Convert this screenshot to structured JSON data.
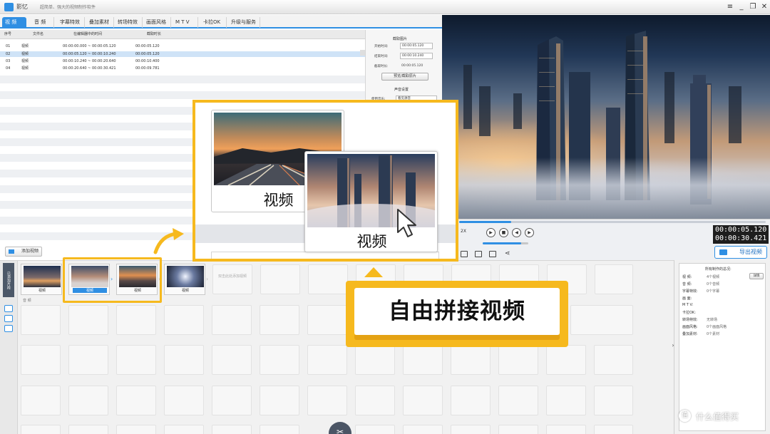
{
  "app": {
    "name": "影忆",
    "slogan": "超简单、强大的视频制作软件",
    "window_buttons": [
      "≡",
      "_",
      "❐",
      "✕"
    ]
  },
  "tabs": [
    {
      "label": "视 频",
      "active": true
    },
    {
      "label": "音 频",
      "active": false
    },
    {
      "label": "字幕特效",
      "active": false
    },
    {
      "label": "叠加素材",
      "active": false
    },
    {
      "label": "转场特效",
      "active": false
    },
    {
      "label": "画面风格",
      "active": false
    },
    {
      "label": "M T V",
      "active": false
    },
    {
      "label": "卡拉OK",
      "active": false
    },
    {
      "label": "升级与服务",
      "active": false
    }
  ],
  "file_list": {
    "headers": [
      "序号",
      "文件名",
      "在编辑器中的时间",
      "截取时长"
    ],
    "rows": [
      {
        "index": "01",
        "name": "视频",
        "range": "00:00:00.000 ~ 00:00:05.120",
        "duration": "00:00:05.120",
        "selected": false
      },
      {
        "index": "02",
        "name": "视频",
        "range": "00:00:05.120 ~ 00:00:10.240",
        "duration": "00:00:05.120",
        "selected": true
      },
      {
        "index": "03",
        "name": "视频",
        "range": "00:00:10.240 ~ 00:00:20.640",
        "duration": "00:00:10.400",
        "selected": false
      },
      {
        "index": "04",
        "name": "视频",
        "range": "00:00:20.640 ~ 00:00:30.421",
        "duration": "00:00:09.781",
        "selected": false
      }
    ]
  },
  "props": {
    "section_title": "截取图片",
    "fields": [
      {
        "label": "开始时间:",
        "value": "00:00:05.120"
      },
      {
        "label": "结束时间:",
        "value": "00:00:10.240"
      },
      {
        "label": "截取时长:",
        "value": "00:00:05.120"
      }
    ],
    "preview_button": "预览/截取原片",
    "audio_title": "声音设置",
    "audio_label": "使用音乐:",
    "audio_value": "看见源音"
  },
  "player": {
    "progress_fraction": 0.17,
    "volume_fraction": 0.85,
    "zoom_label": "2X",
    "current_time": "00:00:05.120",
    "total_time": "00:00:30.421",
    "export_button": "导出视频"
  },
  "timeline": {
    "add_video_button": "添加视频",
    "side_tab": "已添加片段",
    "clips": [
      {
        "label": "视频"
      },
      {
        "label": "视频"
      },
      {
        "label": "视频"
      },
      {
        "label": "视频"
      }
    ],
    "empty_slot_hint": "双击此处添加视频",
    "audio_lane_label": "音 频"
  },
  "stats": {
    "title": "所有制作的总况:",
    "rows": [
      {
        "label": "视   频:",
        "value": "4个视频"
      },
      {
        "label": "音   频:",
        "value": "0个音频"
      },
      {
        "label": "字幕特效:",
        "value": "0个字幕"
      },
      {
        "label": "画   面:",
        "value": ""
      },
      {
        "label": "M T V:",
        "value": ""
      },
      {
        "label": "卡拉OK:",
        "value": ""
      },
      {
        "label": "转场特效:",
        "value": "无转场"
      },
      {
        "label": "画面风格:",
        "value": "0个画面风格"
      },
      {
        "label": "叠加素材:",
        "value": "0个素材"
      }
    ],
    "detail_button": "详情"
  },
  "zoom": {
    "card1_label": "视频",
    "card2_label": "视频"
  },
  "callout": {
    "text": "自由拼接视频"
  },
  "watermark": {
    "icon": "值",
    "text": "什么值得买"
  },
  "colors": {
    "accent": "#2f8fe3",
    "highlight": "#f6b91e"
  }
}
